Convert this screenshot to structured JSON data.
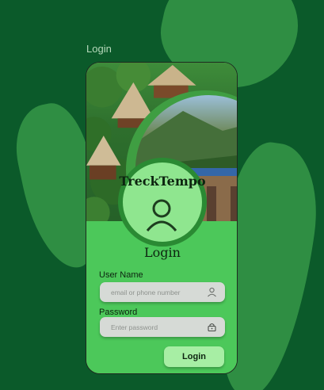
{
  "screen_label": "Login",
  "brand_name": "TreckTempo",
  "form": {
    "title": "Login",
    "username": {
      "label": "User Name",
      "placeholder": "email or phone number",
      "icon": "user-icon"
    },
    "password": {
      "label": "Password",
      "placeholder": "Enter password",
      "icon": "lock-icon"
    },
    "submit_label": "Login"
  },
  "colors": {
    "background": "#0b5a2a",
    "blob": "#2f8e43",
    "panel": "#4cc85a",
    "button": "#a7eea4",
    "avatar": "#8fe68f"
  }
}
